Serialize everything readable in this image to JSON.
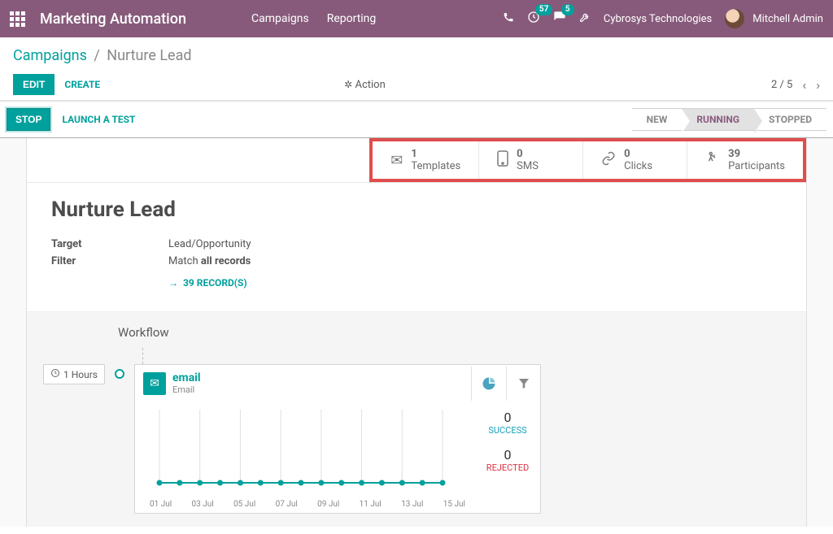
{
  "navbar": {
    "brand": "Marketing Automation",
    "menu": [
      "Campaigns",
      "Reporting"
    ],
    "activities_badge": "57",
    "messages_badge": "5",
    "company": "Cybrosys Technologies",
    "user": "Mitchell Admin"
  },
  "breadcrumb": {
    "parent": "Campaigns",
    "current": "Nurture Lead"
  },
  "buttons": {
    "edit": "EDIT",
    "create": "CREATE",
    "action": "Action",
    "stop": "STOP",
    "launch_test": "LAUNCH A TEST"
  },
  "pager": {
    "text": "2 / 5"
  },
  "status": {
    "new": "NEW",
    "running": "RUNNING",
    "stopped": "STOPPED"
  },
  "stats": {
    "templates": {
      "count": "1",
      "label": "Templates"
    },
    "sms": {
      "count": "0",
      "label": "SMS"
    },
    "clicks": {
      "count": "0",
      "label": "Clicks"
    },
    "participants": {
      "count": "39",
      "label": "Participants"
    }
  },
  "record": {
    "title": "Nurture Lead",
    "target_label": "Target",
    "target_value": "Lead/Opportunity",
    "filter_label": "Filter",
    "filter_prefix": "Match ",
    "filter_value": "all records",
    "records_link": "39 RECORD(S)"
  },
  "workflow": {
    "title": "Workflow",
    "time": "1 Hours",
    "activity_name": "email",
    "activity_type": "Email",
    "success_count": "0",
    "success_label": "SUCCESS",
    "rejected_count": "0",
    "rejected_label": "REJECTED"
  },
  "chart_data": {
    "type": "line",
    "categories": [
      "01 Jul",
      "02 Jul",
      "03 Jul",
      "04 Jul",
      "05 Jul",
      "06 Jul",
      "07 Jul",
      "08 Jul",
      "09 Jul",
      "10 Jul",
      "11 Jul",
      "12 Jul",
      "13 Jul",
      "14 Jul",
      "15 Jul"
    ],
    "tick_labels": [
      "01 Jul",
      "03 Jul",
      "05 Jul",
      "07 Jul",
      "09 Jul",
      "11 Jul",
      "13 Jul",
      "15 Jul"
    ],
    "values": [
      0,
      0,
      0,
      0,
      0,
      0,
      0,
      0,
      0,
      0,
      0,
      0,
      0,
      0,
      0
    ],
    "ylim": [
      0,
      1
    ]
  }
}
